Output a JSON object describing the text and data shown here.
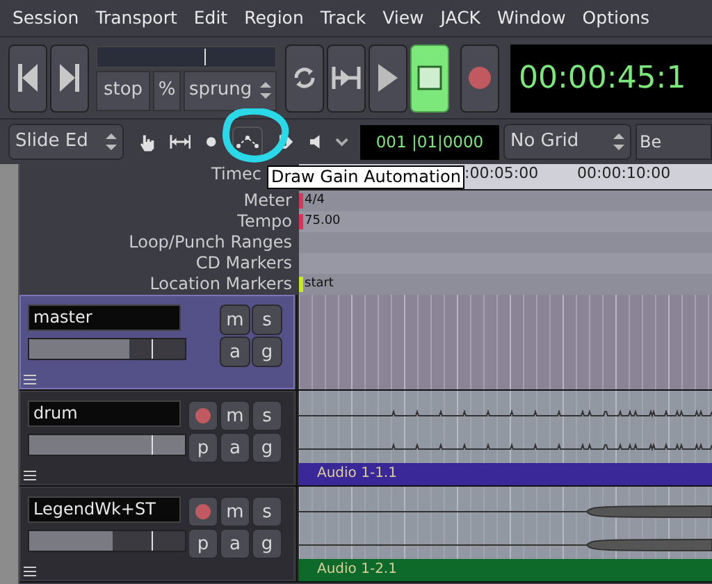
{
  "menu": [
    "Session",
    "Transport",
    "Edit",
    "Region",
    "Track",
    "View",
    "JACK",
    "Window",
    "Options"
  ],
  "transport": {
    "buttons": [
      {
        "kind": "start",
        "active": false
      },
      {
        "kind": "end",
        "active": false
      }
    ],
    "shuttle": {
      "level": 0.6,
      "mode": "stop",
      "unit": "%",
      "style": "sprung"
    },
    "play_buttons": [
      {
        "kind": "loop",
        "active": false
      },
      {
        "kind": "play-range",
        "active": false
      },
      {
        "kind": "play",
        "active": false
      },
      {
        "kind": "stop",
        "active": true
      },
      {
        "kind": "record",
        "active": false
      }
    ],
    "clock": "00:00:45:1"
  },
  "edit_toolbar": {
    "edit_mode": "Slide Ed",
    "tools": [
      {
        "kind": "grab"
      },
      {
        "kind": "range"
      },
      {
        "kind": "cut"
      },
      {
        "kind": "draw"
      },
      {
        "kind": "stretch"
      },
      {
        "kind": "audition"
      },
      {
        "kind": "more"
      }
    ],
    "clock": "001 |01|0000",
    "grid": "No Grid",
    "next": "Be"
  },
  "tooltip": "Draw Gain Automation",
  "rulers": [
    {
      "label": "Timec",
      "marks": [
        ":00:05:00",
        "00:00:10:00"
      ]
    },
    {
      "label": "Meter",
      "marks": [
        "4/4"
      ],
      "color": "#d03a5a"
    },
    {
      "label": "Tempo",
      "marks": [
        "75.00"
      ],
      "color": "#e0305a"
    },
    {
      "label": "Loop/Punch Ranges"
    },
    {
      "label": "CD Markers"
    },
    {
      "label": "Location Markers",
      "marks": [
        "start"
      ],
      "color": "#c8e820"
    }
  ],
  "tracks": [
    {
      "name": "master",
      "kind": "bus",
      "selected": true,
      "level": 0.64,
      "top": [
        "m",
        "s"
      ],
      "bottom": [
        "a",
        "g"
      ]
    },
    {
      "name": "drum",
      "kind": "audio",
      "selected": false,
      "level": 1,
      "top": [
        "m",
        "s"
      ],
      "bottom": [
        "p",
        "a",
        "g"
      ],
      "region": "Audio 1-1.1",
      "color": "#3a2898"
    },
    {
      "name": "LegendWk+ST",
      "kind": "audio",
      "selected": false,
      "level": 0.54,
      "top": [
        "m",
        "s"
      ],
      "bottom": [
        "p",
        "a",
        "g"
      ],
      "region": "Audio 1-2.1",
      "color": "#0e6a2a"
    }
  ]
}
